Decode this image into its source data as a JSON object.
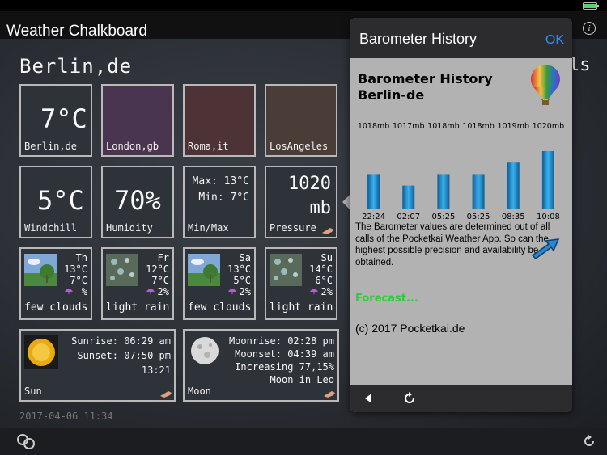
{
  "app": {
    "title": "Weather Chalkboard"
  },
  "city": "Berlin,de",
  "right_edge_fragment": "ls",
  "tiles_row1": [
    {
      "value": "7°C",
      "label": "Berlin,de",
      "color": "#2e333a"
    },
    {
      "value": "",
      "label": "London,gb",
      "color": "#4a3550"
    },
    {
      "value": "",
      "label": "Roma,it",
      "color": "#4d3335"
    },
    {
      "value": "",
      "label": "LosAngeles",
      "color": "#4a3d38"
    }
  ],
  "tiles_row2": [
    {
      "value": "5°C",
      "label": "Windchill"
    },
    {
      "value": "70%",
      "label": "Humidity"
    },
    {
      "max": "Max: 13°C",
      "min": "Min: 7°C",
      "label": "Min/Max"
    },
    {
      "value1": "1020",
      "value2": "mb",
      "label": "Pressure"
    }
  ],
  "forecast": [
    {
      "day": "Th",
      "high": "13°C",
      "low": "7°C",
      "rain": "%",
      "desc": "few clouds"
    },
    {
      "day": "Fr",
      "high": "12°C",
      "low": "7°C",
      "rain": "2%",
      "desc": "light rain"
    },
    {
      "day": "Sa",
      "high": "13°C",
      "low": "5°C",
      "rain": "2%",
      "desc": "few clouds"
    },
    {
      "day": "Su",
      "high": "14°C",
      "low": "6°C",
      "rain": "2%",
      "desc": "light rain"
    }
  ],
  "sun": {
    "sunrise": "Sunrise: 06:29 am",
    "sunset": "Sunset: 07:50 pm",
    "duration": "13:21",
    "label": "Sun"
  },
  "moon": {
    "moonrise": "Moonrise: 02:28 pm",
    "moonset": "Moonset: 04:39 am",
    "phase": "Increasing  77,15%",
    "sign": "Moon in Leo",
    "label": "Moon"
  },
  "timestamp": "2017-04-06 11:34",
  "popover": {
    "title": "Barometer History",
    "ok": "OK",
    "heading_line1": "Barometer History",
    "heading_line2": "Berlin-de",
    "description": "The Barometer values are determined out of all calls of the Pocketkai Weather App. So can the highest possible precision and availability be obtained.",
    "forecast_link": "Forecast...",
    "copyright": "(c) 2017 Pocketkai.de"
  },
  "chart_data": {
    "type": "bar",
    "categories": [
      "22:24",
      "02:07",
      "05:25",
      "05:25",
      "08:35",
      "10:08"
    ],
    "values": [
      1018,
      1017,
      1018,
      1018,
      1019,
      1020
    ],
    "value_labels": [
      "1018mb",
      "1017mb",
      "1018mb",
      "1018mb",
      "1019mb",
      "1020mb"
    ],
    "title": "",
    "xlabel": "",
    "ylabel": "",
    "ylim": [
      1015,
      1020
    ],
    "bar_color": "#1f8fd1"
  },
  "colors": {
    "ok_blue": "#2f8cff",
    "forecast_green": "#2fcb3a"
  }
}
